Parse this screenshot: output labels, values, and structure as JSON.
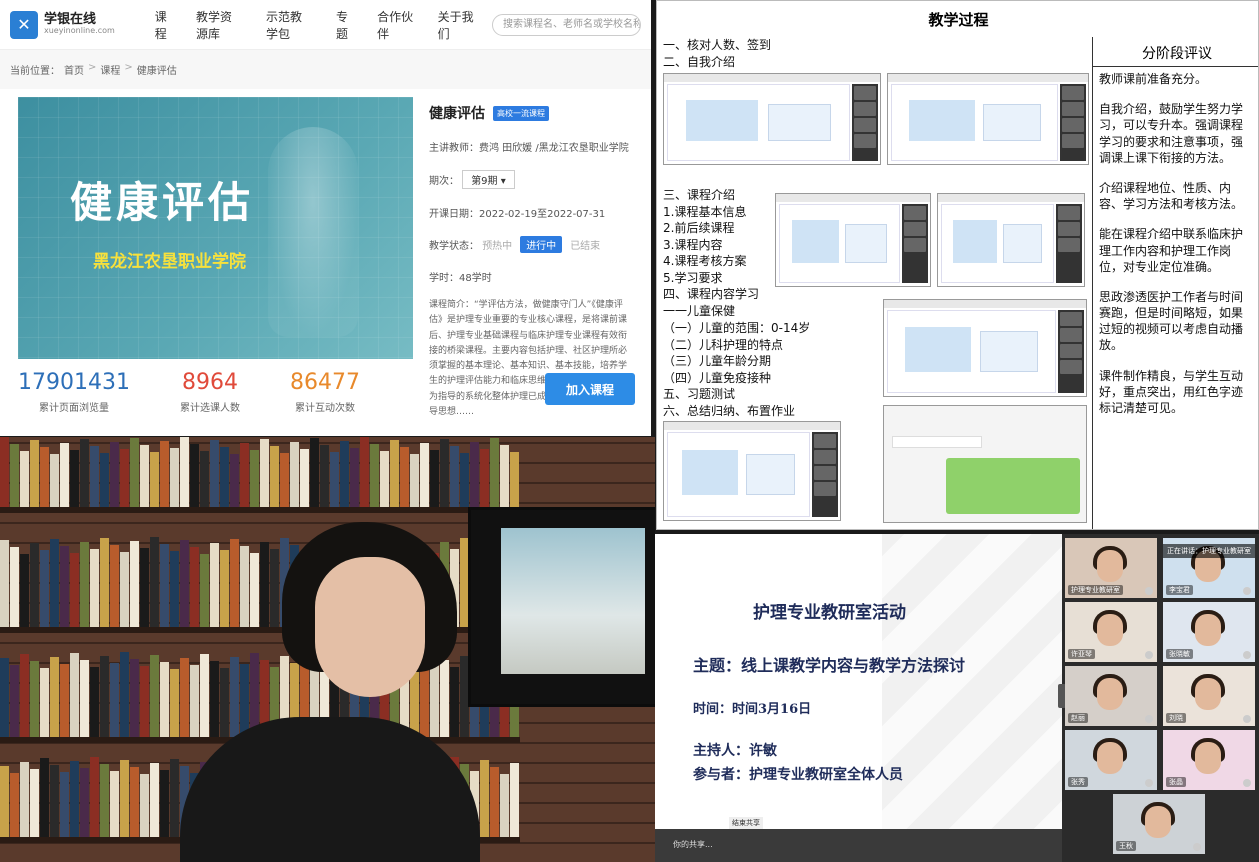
{
  "web": {
    "logo_cn": "学银在线",
    "logo_en": "xueyinonline.com",
    "nav": [
      "课程",
      "教学资源库",
      "示范教学包",
      "专题",
      "合作伙伴",
      "关于我们"
    ],
    "search_placeholder": "搜索课程名、老师名或学校名称",
    "crumb": [
      "当前位置：",
      "首页",
      "课程",
      "健康评估"
    ],
    "cover_title": "健康评估",
    "cover_school": "黑龙江农垦职业学院",
    "course_title": "健康评估",
    "badge": "高校一流课程",
    "teacher_row": "主讲教师：费鸿 田欣媛 /黑龙江农垦职业学院",
    "term_label": "期次：",
    "term_value": "第9期",
    "date_row": "开课日期：2022-02-19至2022-07-31",
    "status_label": "教学状态：",
    "status_before": "预热中",
    "status_now": "进行中",
    "status_after": "已结束",
    "hours_row": "学时：48学时",
    "intro": "课程简介：“学评估方法，做健康守门人”《健康评估》是护理专业重要的专业核心课程，是将课前课后、护理专业基础课程与临床护理专业课程有效衔接的桥梁课程。主要内容包括护理、社区护理所必须掌握的基本理论、基本知识、基本技能，培养学生的护理评估能力和临床思维能力，并以护理程序为指导的系统化整体护理已成为现代护理模式的主导思想……",
    "stats": [
      {
        "value": "17901431",
        "label": "累计页面浏览量",
        "color": "#2d6fb8"
      },
      {
        "value": "8964",
        "label": "累计选课人数",
        "color": "#e04a3a"
      },
      {
        "value": "86477",
        "label": "累计互动次数",
        "color": "#e8892b"
      }
    ],
    "join_label": "加入课程"
  },
  "doc": {
    "title": "教学过程",
    "col_title": "分阶段评议",
    "outline_a": [
      "一、核对人数、签到",
      "二、自我介绍"
    ],
    "outline_b": [
      "三、课程介绍",
      "1.课程基本信息",
      "2.前后续课程",
      "3.课程内容",
      "4.课程考核方案",
      "5.学习要求",
      "四、课程内容学习",
      "一一儿童保健"
    ],
    "outline_c": [
      "（一）儿童的范围：0-14岁",
      "（二）儿科护理的特点",
      "（三）儿童年龄分期",
      "（四）儿童免疫接种",
      "五、习题测试",
      "六、总结归纳、布置作业"
    ],
    "evals": [
      "教师课前准备充分。",
      "自我介绍，鼓励学生努力学习，可以专升本。强调课程学习的要求和注意事项，强调课上课下衔接的方法。",
      "介绍课程地位、性质、内容、学习方法和考核方法。",
      "能在课程介绍中联系临床护理工作内容和护理工作岗位，对专业定位准确。",
      "思政渗透医护工作者与时间赛跑，但是时间略短，如果过短的视频可以考虑自动播放。",
      "课件制作精良，与学生互动好，重点突出，用红色字迹标记清楚可见。"
    ]
  },
  "meeting": {
    "slide_title": "护理专业教研室活动",
    "slide_theme": "主题：线上课教学内容与教学方法探讨",
    "slide_time": "时间：时间3月16日",
    "slide_host": "主持人：许敏",
    "slide_part": "参与者：护理专业教研室全体人员",
    "share_badge": "结束共享",
    "sharing_text": "你的共享...",
    "notice": "正在讲话：护理专业教研室",
    "participants": [
      "护理专业教研室",
      "李宝君",
      "许亚琴",
      "张晓敏",
      "赵丽",
      "刘晓",
      "张秀",
      "张晶",
      "王秋"
    ]
  }
}
